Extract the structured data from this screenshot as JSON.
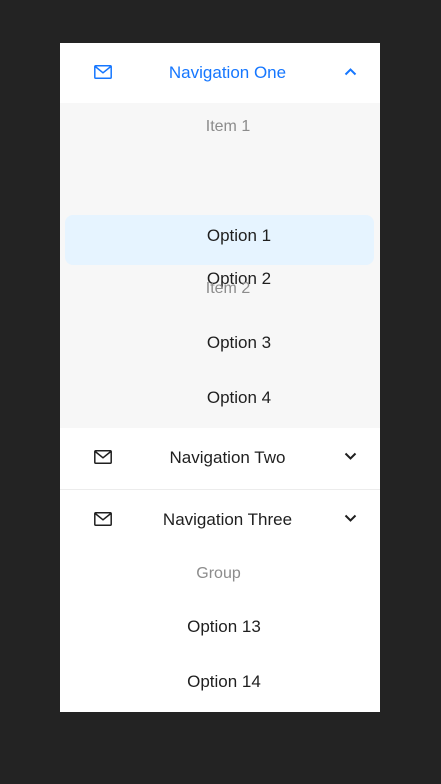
{
  "theme": {
    "accent": "#1677ff",
    "selected_bg": "#e6f4ff",
    "submenu_bg": "#f7f7f7",
    "page_bg": "#232323",
    "text": "#1f1f1f",
    "muted": "#8c8c8c"
  },
  "menu": {
    "nav_one": {
      "label": "Navigation One",
      "icon": "mail-icon",
      "expand_icon": "chevron-up-icon",
      "groups": [
        {
          "title": "Item 1",
          "items": [
            "Option 1",
            "Option 2"
          ]
        },
        {
          "title": "Item 2",
          "items": [
            "Option 3",
            "Option 4"
          ]
        }
      ],
      "selected": "Option 1"
    },
    "nav_two": {
      "label": "Navigation Two",
      "icon": "mail-icon",
      "expand_icon": "chevron-down-icon"
    },
    "nav_three": {
      "label": "Navigation Three",
      "icon": "mail-icon",
      "expand_icon": "chevron-down-icon",
      "group": {
        "title": "Group",
        "items": [
          "Option 13",
          "Option 14"
        ]
      }
    }
  }
}
